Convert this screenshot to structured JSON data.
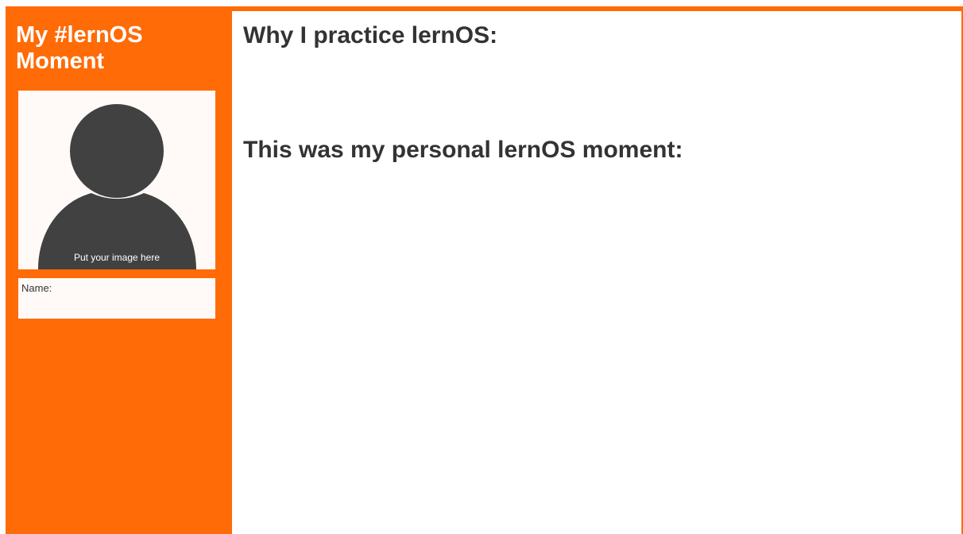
{
  "sidebar": {
    "title_line1": "My #lernOS",
    "title_line2": "Moment",
    "photo": {
      "icon": "person-silhouette-icon",
      "caption": "Put your image here"
    },
    "name_label": "Name:"
  },
  "main": {
    "heading_why": "Why I practice lernOS:",
    "heading_moment": "This was my personal lernOS moment:"
  },
  "colors": {
    "accent_orange": "#ff6b06",
    "panel_white": "#ffffff",
    "box_fill": "#fffaf7",
    "silhouette": "#414141",
    "text_dark": "#333333"
  }
}
